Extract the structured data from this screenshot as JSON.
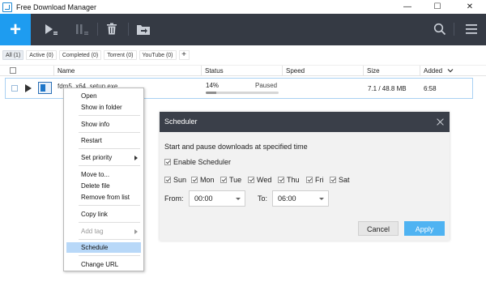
{
  "window": {
    "title": "Free Download Manager",
    "controls": {
      "minimize": "—",
      "maximize": "☐",
      "close": "✕"
    }
  },
  "toolbar": {
    "add_label": "+",
    "icons": [
      "play-icon",
      "pause-icon",
      "trash-icon",
      "move-icon",
      "search-icon",
      "menu-icon"
    ],
    "accent_color": "#1e9cf0",
    "background_color": "#353a44"
  },
  "filters": {
    "tabs": [
      "All (1)",
      "Active (0)",
      "Completed (0)",
      "Torrent (0)",
      "YouTube (0)"
    ],
    "selected": "All (1)",
    "add_label": "+"
  },
  "table": {
    "headers": {
      "name": "Name",
      "status": "Status",
      "speed": "Speed",
      "size": "Size",
      "added": "Added"
    },
    "rows": [
      {
        "name": "fdm5_x64_setup.exe",
        "percent_label": "14%",
        "progress": 0.14,
        "status": "Paused",
        "speed": "",
        "size": "7.1 / 48.8 MB",
        "added": "6:58"
      }
    ]
  },
  "context_menu": {
    "items": [
      {
        "label": "Open",
        "disabled": false
      },
      {
        "label": "Show in folder",
        "disabled": false
      },
      {
        "label": "Show info",
        "disabled": false
      },
      {
        "label": "Restart",
        "disabled": false
      },
      {
        "label": "Set priority",
        "disabled": false,
        "submenu": true
      },
      {
        "label": "Move to...",
        "disabled": false
      },
      {
        "label": "Delete file",
        "disabled": false
      },
      {
        "label": "Remove from list",
        "disabled": false
      },
      {
        "label": "Copy link",
        "disabled": false
      },
      {
        "label": "Add tag",
        "disabled": true,
        "submenu": true
      },
      {
        "label": "Schedule",
        "disabled": false,
        "highlighted": true
      },
      {
        "label": "Change URL",
        "disabled": false
      }
    ]
  },
  "scheduler": {
    "title": "Scheduler",
    "description": "Start and pause downloads at specified time",
    "enable_label": "Enable Scheduler",
    "enabled": true,
    "days": [
      {
        "label": "Sun",
        "checked": true
      },
      {
        "label": "Mon",
        "checked": true
      },
      {
        "label": "Tue",
        "checked": true
      },
      {
        "label": "Wed",
        "checked": true
      },
      {
        "label": "Thu",
        "checked": true
      },
      {
        "label": "Fri",
        "checked": true
      },
      {
        "label": "Sat",
        "checked": true
      }
    ],
    "from_label": "From:",
    "from_value": "00:00",
    "to_label": "To:",
    "to_value": "06:00",
    "cancel_label": "Cancel",
    "apply_label": "Apply"
  }
}
